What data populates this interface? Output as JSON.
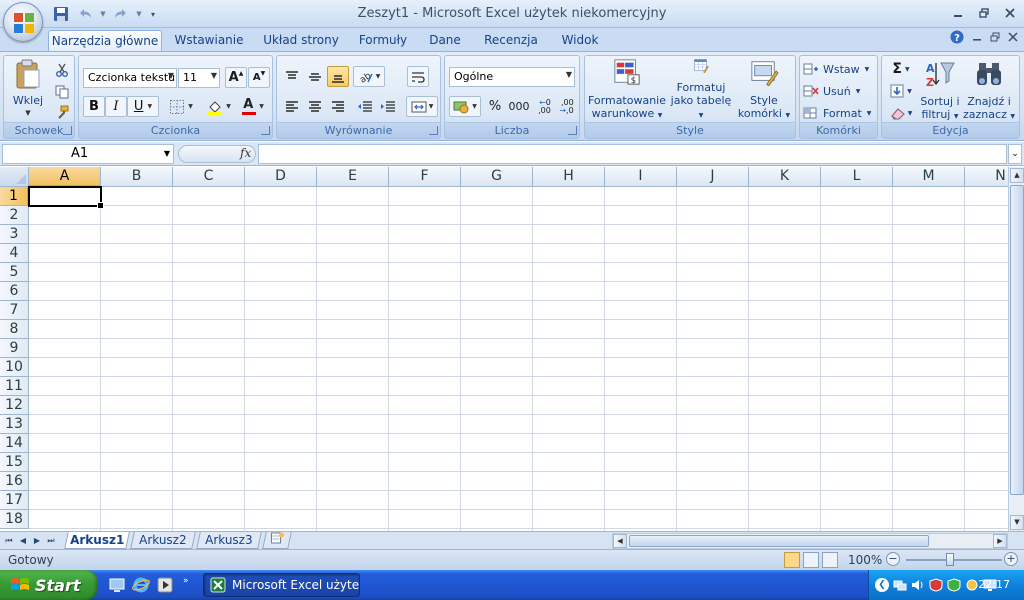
{
  "window": {
    "title": "Zeszyt1 - Microsoft Excel użytek niekomercyjny"
  },
  "ribbon": {
    "tabs": [
      "Narzędzia główne",
      "Wstawianie",
      "Układ strony",
      "Formuły",
      "Dane",
      "Recenzja",
      "Widok"
    ],
    "active_tab": "Narzędzia główne",
    "clipboard": {
      "label": "Schowek",
      "paste": "Wklej"
    },
    "font": {
      "label": "Czcionka",
      "font_name": "Czcionka tekstu",
      "font_size": "11",
      "bold": "B",
      "italic": "I",
      "underline": "U",
      "font_color_glyph": "A",
      "grow": "A",
      "shrink": "A"
    },
    "alignment": {
      "label": "Wyrównanie"
    },
    "number": {
      "label": "Liczba",
      "format": "Ogólne",
      "percent": "%",
      "thousands": "000",
      "inc_decimal": ",00",
      "dec_decimal": ",00"
    },
    "styles": {
      "label": "Style",
      "conditional": [
        "Formatowanie",
        "warunkowe"
      ],
      "as_table": [
        "Formatuj",
        "jako tabelę"
      ],
      "cell_styles": [
        "Style",
        "komórki"
      ]
    },
    "cells": {
      "label": "Komórki",
      "insert": "Wstaw",
      "delete": "Usuń",
      "format": "Format"
    },
    "editing": {
      "label": "Edycja",
      "sort": [
        "Sortuj i",
        "filtruj"
      ],
      "find": [
        "Znajdź i",
        "zaznacz"
      ]
    }
  },
  "formula_bar": {
    "name_box": "A1",
    "fx": "fx",
    "formula": ""
  },
  "sheet": {
    "columns": [
      "A",
      "B",
      "C",
      "D",
      "E",
      "F",
      "G",
      "H",
      "I",
      "J",
      "K",
      "L",
      "M",
      "N"
    ],
    "rows": [
      "1",
      "2",
      "3",
      "4",
      "5",
      "6",
      "7",
      "8",
      "9",
      "10",
      "11",
      "12",
      "13",
      "14",
      "15",
      "16",
      "17",
      "18"
    ],
    "active_cell": "A1",
    "tabs": [
      "Arkusz1",
      "Arkusz2",
      "Arkusz3"
    ],
    "active_tab": "Arkusz1"
  },
  "status": {
    "text": "Gotowy",
    "zoom": "100%",
    "zoom_out": "−",
    "zoom_in": "+"
  },
  "taskbar": {
    "start": "Start",
    "task_button": "Microsoft Excel użyte...",
    "clock": "22:17"
  },
  "colors": {
    "ribbon": "#dbe7f6",
    "accent_selection": "#f1c15f",
    "taskbar": "#245edb",
    "start": "#3a9a36"
  }
}
